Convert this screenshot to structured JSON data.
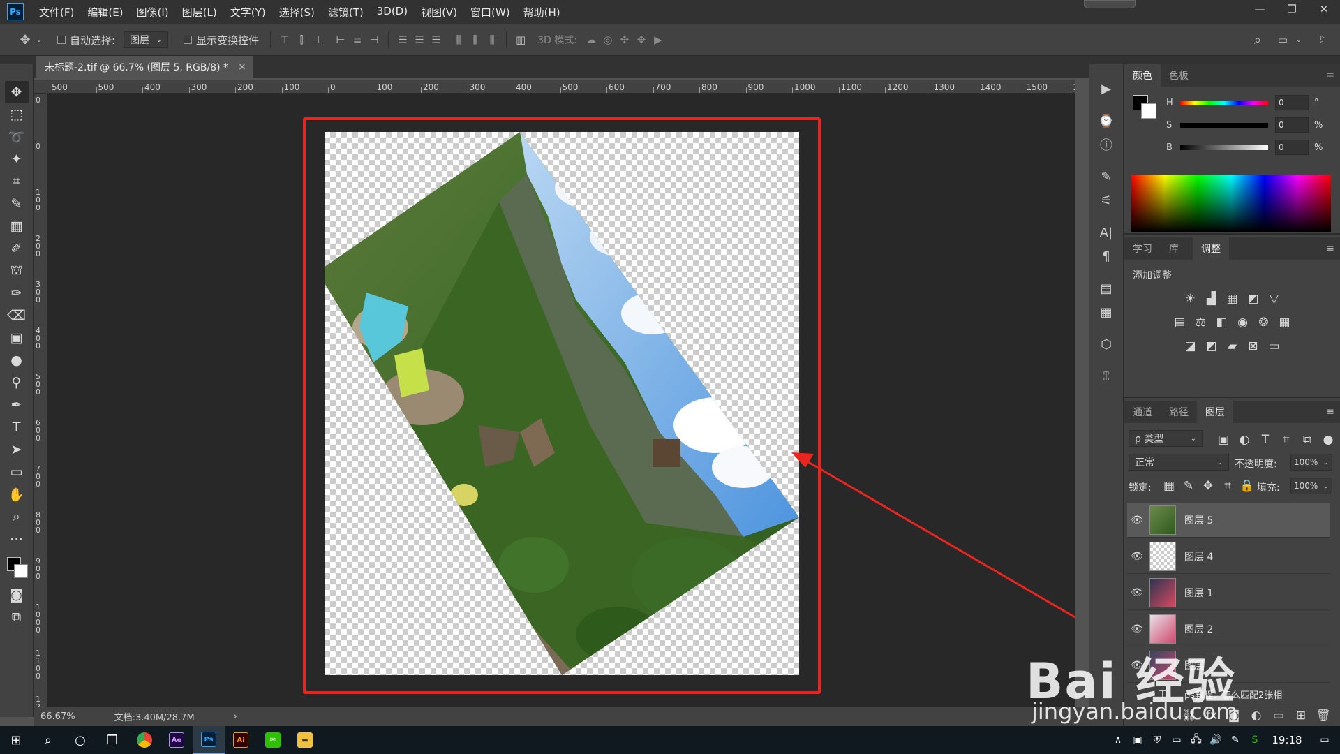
{
  "app": {
    "logo": "Ps"
  },
  "menu": [
    "文件(F)",
    "编辑(E)",
    "图像(I)",
    "图层(L)",
    "文字(Y)",
    "选择(S)",
    "滤镜(T)",
    "3D(D)",
    "视图(V)",
    "窗口(W)",
    "帮助(H)"
  ],
  "window_controls": {
    "minimize": "—",
    "restore": "❐",
    "close": "✕"
  },
  "options": {
    "auto_select_label": "自动选择:",
    "auto_select_value": "图层",
    "show_transform_label": "显示变换控件",
    "mode_3d_label": "3D 模式:"
  },
  "document": {
    "tab_title": "未标题-2.tif @ 66.7% (图层 5, RGB/8) *",
    "close": "×"
  },
  "ruler_h_labels": [
    "500",
    "500",
    "400",
    "300",
    "200",
    "100",
    "0",
    "100",
    "200",
    "300",
    "400",
    "500",
    "600",
    "700",
    "800",
    "900",
    "1000",
    "1100",
    "1200",
    "1300",
    "1400",
    "1500",
    "1"
  ],
  "ruler_v_labels": [
    "0",
    "0",
    "100",
    "200",
    "300",
    "400",
    "500",
    "600",
    "700",
    "800",
    "900",
    "1000",
    "1100",
    "1200"
  ],
  "status": {
    "zoom": "66.67%",
    "doc": "文档:3.40M/28.7M",
    "arrow": "›"
  },
  "color_panel": {
    "tabs": [
      "颜色",
      "色板"
    ],
    "active_tab": 0,
    "h": {
      "label": "H",
      "value": "0",
      "unit": "°"
    },
    "s": {
      "label": "S",
      "value": "0",
      "unit": "%"
    },
    "b": {
      "label": "B",
      "value": "0",
      "unit": "%"
    }
  },
  "adjust_panel": {
    "tabs": [
      "学习",
      "库",
      "调整"
    ],
    "active_tab": 2,
    "heading": "添加调整"
  },
  "layers_panel": {
    "tabs": [
      "通道",
      "路径",
      "图层"
    ],
    "active_tab": 2,
    "filter_kind": "ρ 类型",
    "blend_mode": "正常",
    "opacity_label": "不透明度:",
    "opacity_value": "100%",
    "lock_label": "锁定:",
    "fill_label": "填充:",
    "fill_value": "100%",
    "layers": [
      {
        "name": "图层 5",
        "selected": true
      },
      {
        "name": "图层 4",
        "selected": false
      },
      {
        "name": "图层 1",
        "selected": false
      },
      {
        "name": "图层 2",
        "selected": false
      },
      {
        "name": "图层",
        "selected": false
      }
    ],
    "partial_text_layer": "ps教程：怎么匹配2张相"
  },
  "taskbar": {
    "time": "19:18"
  },
  "watermark": {
    "main": "Bai 经验",
    "sub": "jingyan.baidu.com"
  },
  "colors": {
    "highlight": "#e8251f",
    "accent": "#31a8ff"
  }
}
